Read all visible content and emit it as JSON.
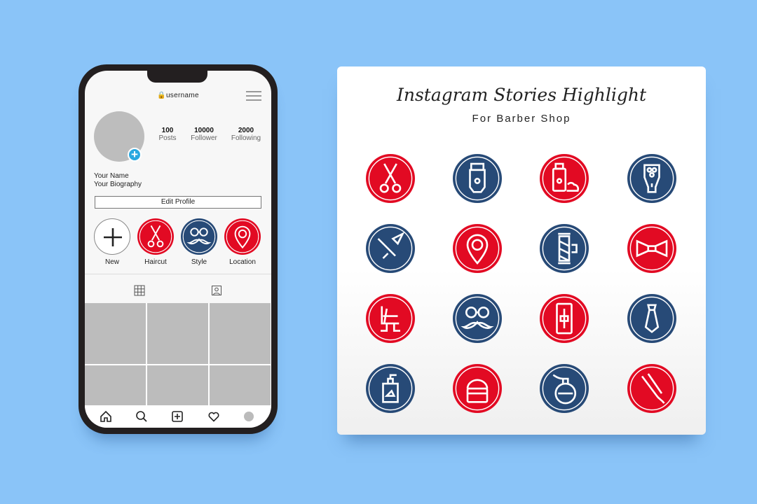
{
  "colors": {
    "background": "#8ac4f8",
    "red": "#e20a23",
    "blue": "#274a77",
    "add_badge": "#29a8e0"
  },
  "profile": {
    "username": "username",
    "stats": [
      {
        "value": "100",
        "label": "Posts"
      },
      {
        "value": "10000",
        "label": "Follower"
      },
      {
        "value": "2000",
        "label": "Following"
      }
    ],
    "name": "Your Name",
    "biography": "Your Biography",
    "edit_label": "Edit Profile",
    "highlights": [
      {
        "label": "New",
        "icon": "plus"
      },
      {
        "label": "Haircut",
        "icon": "scissors",
        "color": "red"
      },
      {
        "label": "Style",
        "icon": "glasses-mustache",
        "color": "blue"
      },
      {
        "label": "Location",
        "icon": "location-pin",
        "color": "red"
      }
    ],
    "tabs": [
      "grid-icon",
      "tagged-icon"
    ],
    "nav": [
      "home-icon",
      "search-icon",
      "add-post-icon",
      "heart-icon",
      "profile-icon"
    ]
  },
  "card": {
    "title": "Instagram Stories Highlight",
    "subtitle": "For Barber Shop",
    "icons": [
      {
        "icon": "scissors",
        "color": "red"
      },
      {
        "icon": "hair-clipper",
        "color": "blue"
      },
      {
        "icon": "shaving-cream",
        "color": "red"
      },
      {
        "icon": "electric-shaver",
        "color": "blue"
      },
      {
        "icon": "straight-razor",
        "color": "blue"
      },
      {
        "icon": "location-pin",
        "color": "red"
      },
      {
        "icon": "barber-pole",
        "color": "blue"
      },
      {
        "icon": "bow-tie",
        "color": "red"
      },
      {
        "icon": "barber-chair",
        "color": "red"
      },
      {
        "icon": "glasses-mustache",
        "color": "blue"
      },
      {
        "icon": "razor-blade",
        "color": "red"
      },
      {
        "icon": "necktie",
        "color": "blue"
      },
      {
        "icon": "pump-bottle",
        "color": "blue"
      },
      {
        "icon": "cream-jar",
        "color": "red"
      },
      {
        "icon": "perfume-bottle",
        "color": "blue"
      },
      {
        "icon": "hair-straightener",
        "color": "red"
      }
    ]
  }
}
